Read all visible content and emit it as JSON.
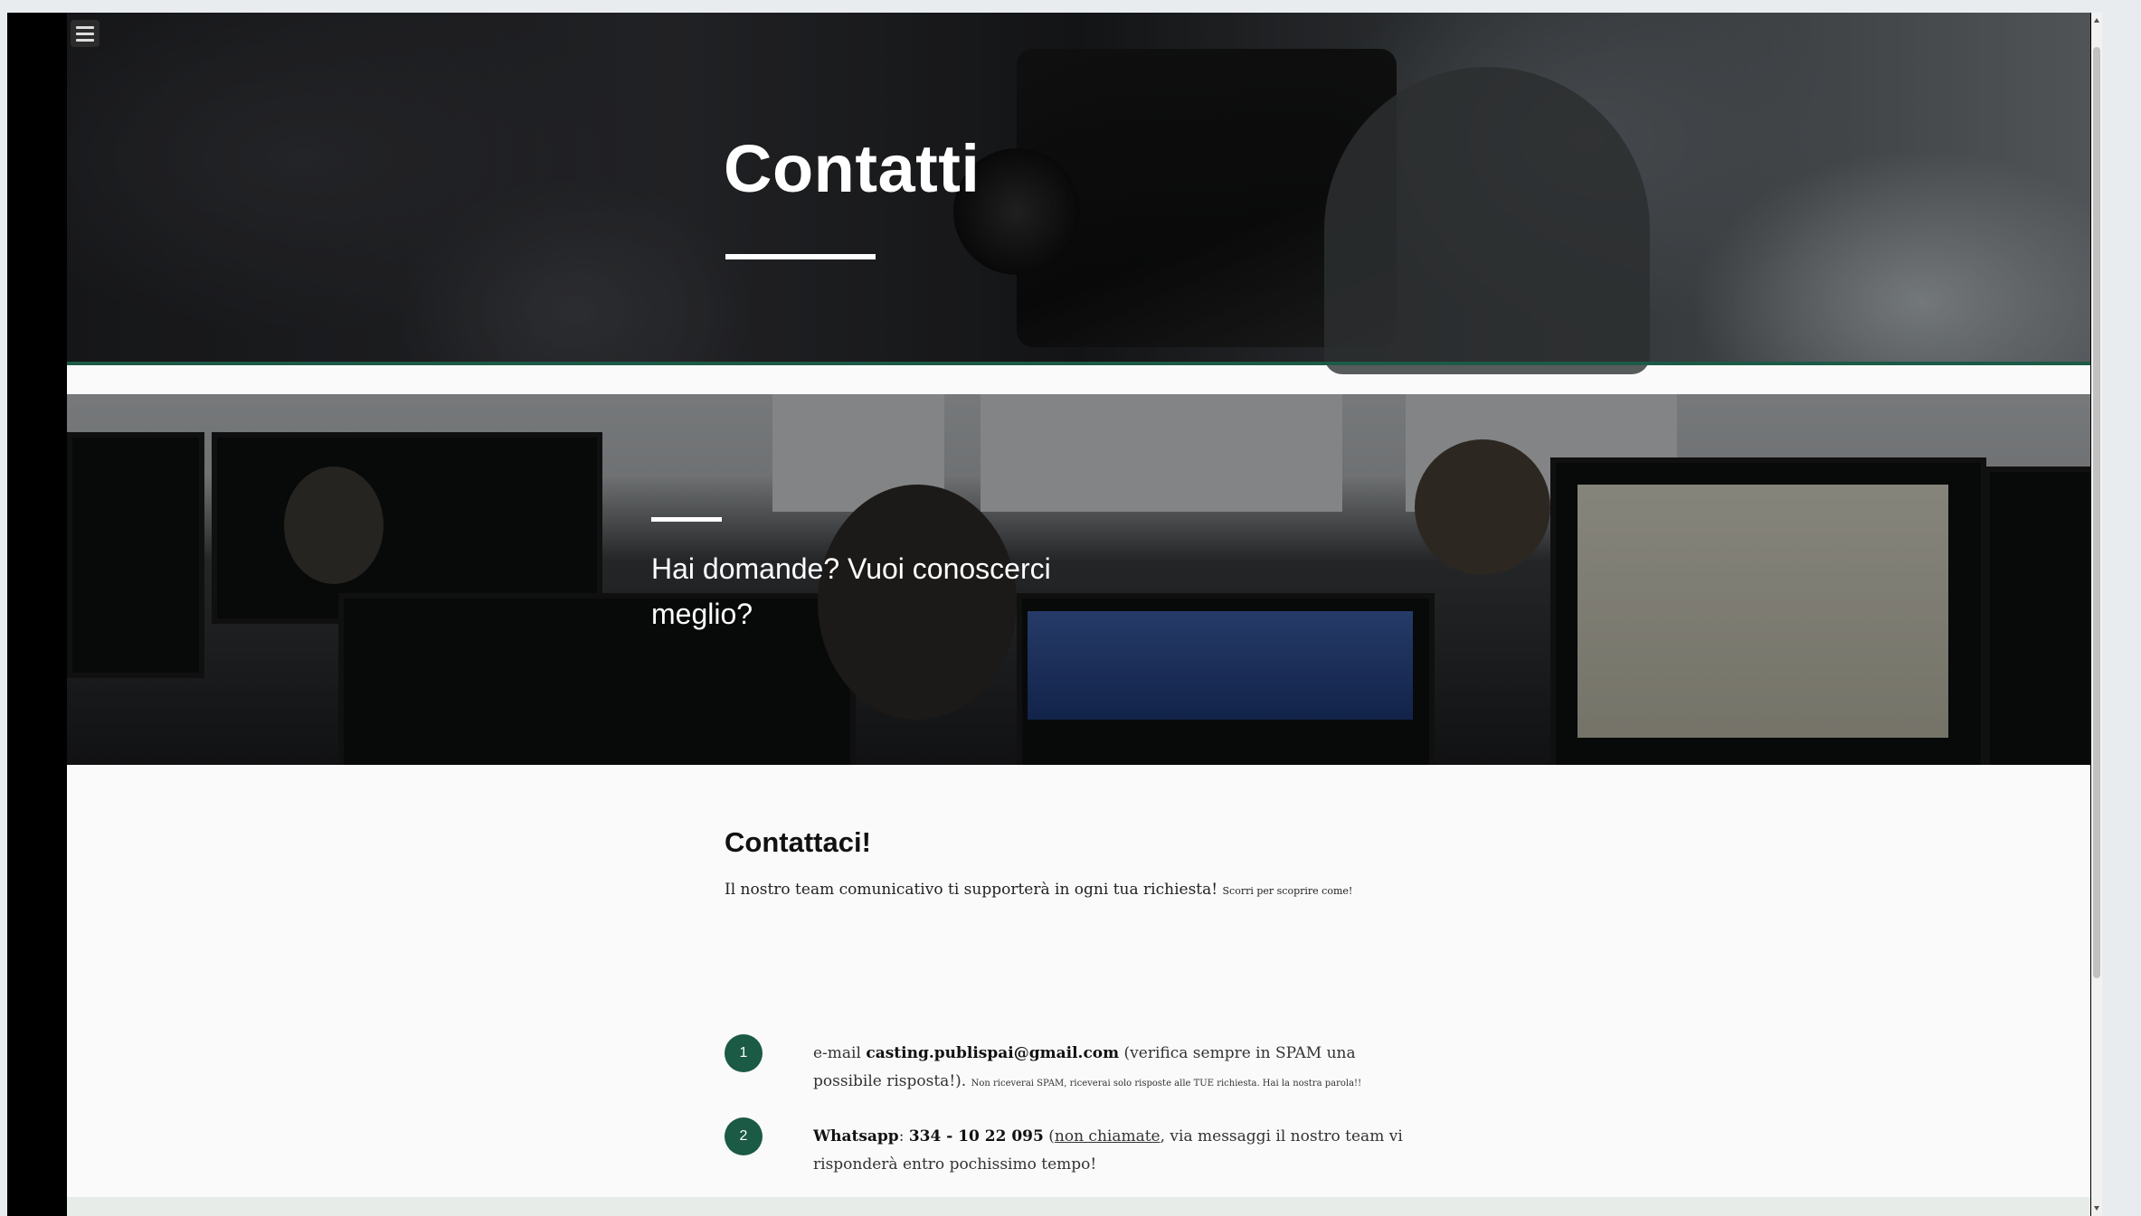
{
  "hero": {
    "title": "Contatti"
  },
  "band": {
    "tagline": "Hai domande? Vuoi conoscerci meglio?"
  },
  "contact": {
    "title": "Contattaci!",
    "subtitle": "Il nostro team comunicativo ti supporterà in ogni tua richiesta!",
    "subtitle_small": "Scorri per scoprire come!",
    "steps": [
      {
        "number": "1",
        "prefix": "e-mail",
        "highlight": "casting.publispai@gmail.com",
        "note": "(verifica sempre in SPAM una possibile risposta!).",
        "small": "Non riceverai SPAM, riceverai solo risposte alle TUE richiesta. Hai la nostra parola!!"
      },
      {
        "number": "2",
        "prefix": "Whatsapp",
        "highlight": "334 - 10 22 095",
        "underlined": "non chiamate",
        "note_after": ", via messaggi il nostro team vi risponderà entro pochissimo tempo!"
      }
    ]
  },
  "icons": {
    "menu": "hamburger-menu-icon"
  },
  "colors": {
    "accent": "#1b5a45",
    "hero_text": "#ffffff"
  }
}
